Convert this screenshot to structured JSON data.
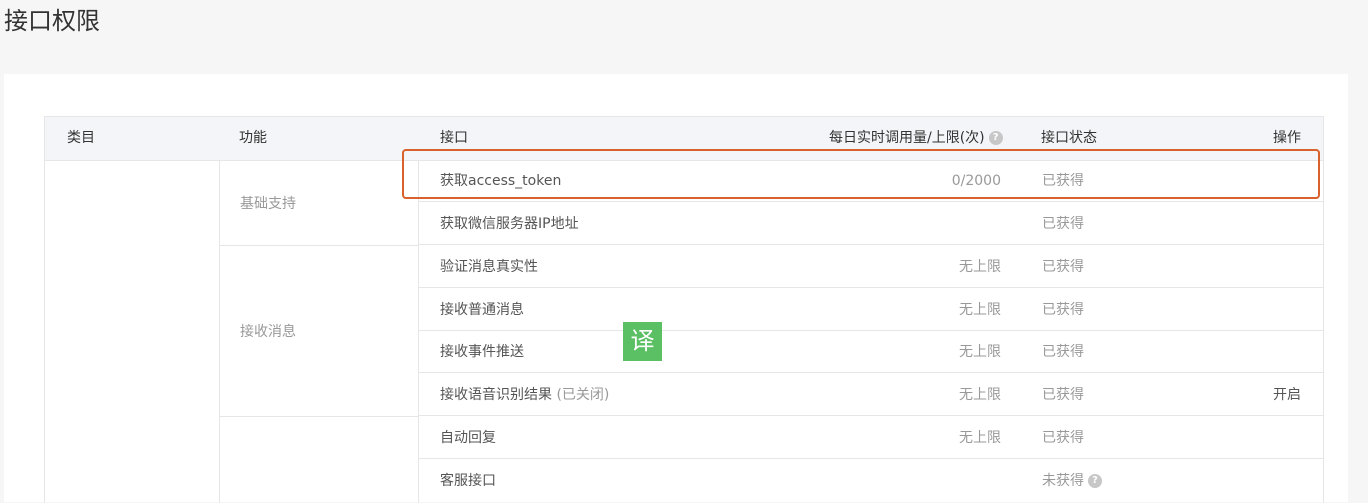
{
  "page": {
    "title": "接口权限"
  },
  "table": {
    "headers": {
      "category": "类目",
      "function": "功能",
      "api": "接口",
      "quota": "每日实时调用量/上限(次)",
      "status": "接口状态",
      "action": "操作"
    },
    "groups": [
      {
        "name": "基础支持"
      },
      {
        "name": "接收消息"
      },
      {
        "name": ""
      }
    ],
    "rows": [
      {
        "api": "获取access_token",
        "note": "",
        "quota": "0/2000",
        "status": "已获得",
        "action": ""
      },
      {
        "api": "获取微信服务器IP地址",
        "note": "",
        "quota": "",
        "status": "已获得",
        "action": ""
      },
      {
        "api": "验证消息真实性",
        "note": "",
        "quota": "无上限",
        "status": "已获得",
        "action": ""
      },
      {
        "api": "接收普通消息",
        "note": "",
        "quota": "无上限",
        "status": "已获得",
        "action": ""
      },
      {
        "api": "接收事件推送",
        "note": "",
        "quota": "无上限",
        "status": "已获得",
        "action": ""
      },
      {
        "api": "接收语音识别结果",
        "note": "(已关闭)",
        "quota": "无上限",
        "status": "已获得",
        "action": "开启"
      },
      {
        "api": "自动回复",
        "note": "",
        "quota": "无上限",
        "status": "已获得",
        "action": ""
      },
      {
        "api": "客服接口",
        "note": "",
        "quota": "",
        "status": "未获得",
        "action": ""
      }
    ]
  },
  "overlay": {
    "translate_label": "译"
  },
  "colors": {
    "highlight": "#d9622c",
    "translate_badge": "#5bbf63"
  },
  "icons": {
    "help": "question-circle-icon"
  }
}
